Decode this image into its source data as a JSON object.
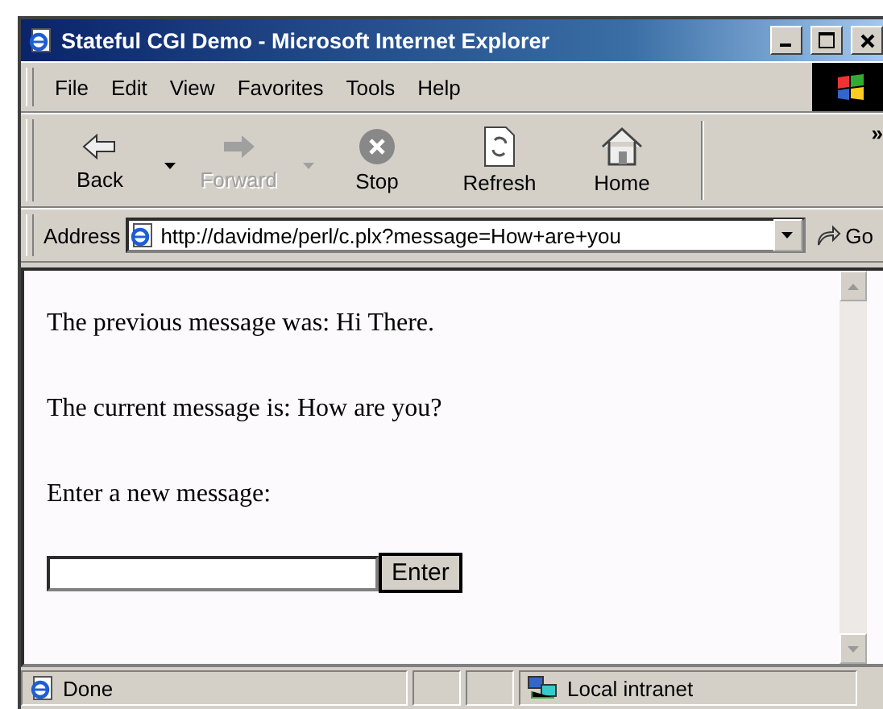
{
  "window": {
    "title": "Stateful CGI Demo - Microsoft Internet Explorer"
  },
  "menu": [
    {
      "label": "File"
    },
    {
      "label": "Edit"
    },
    {
      "label": "View"
    },
    {
      "label": "Favorites"
    },
    {
      "label": "Tools"
    },
    {
      "label": "Help"
    }
  ],
  "toolbar": [
    {
      "kind": "back",
      "label": "Back",
      "disabled": false,
      "dropdown": true
    },
    {
      "kind": "forward",
      "label": "Forward",
      "disabled": true,
      "dropdown": true
    },
    {
      "kind": "stop",
      "label": "Stop",
      "disabled": false,
      "dropdown": false
    },
    {
      "kind": "refresh",
      "label": "Refresh",
      "disabled": false,
      "dropdown": false
    },
    {
      "kind": "home",
      "label": "Home",
      "disabled": false,
      "dropdown": false
    }
  ],
  "toolbar_more": "»",
  "address": {
    "label": "Address",
    "value": "http://davidme/perl/c.plx?message=How+are+you",
    "go": "Go"
  },
  "page": {
    "paragraphs": [
      "The previous message was: Hi There.",
      "The current message is: How are you?",
      "Enter a new message:"
    ],
    "button": "Enter"
  },
  "status_bar": {
    "text": "Done",
    "zone": "Local intranet"
  }
}
